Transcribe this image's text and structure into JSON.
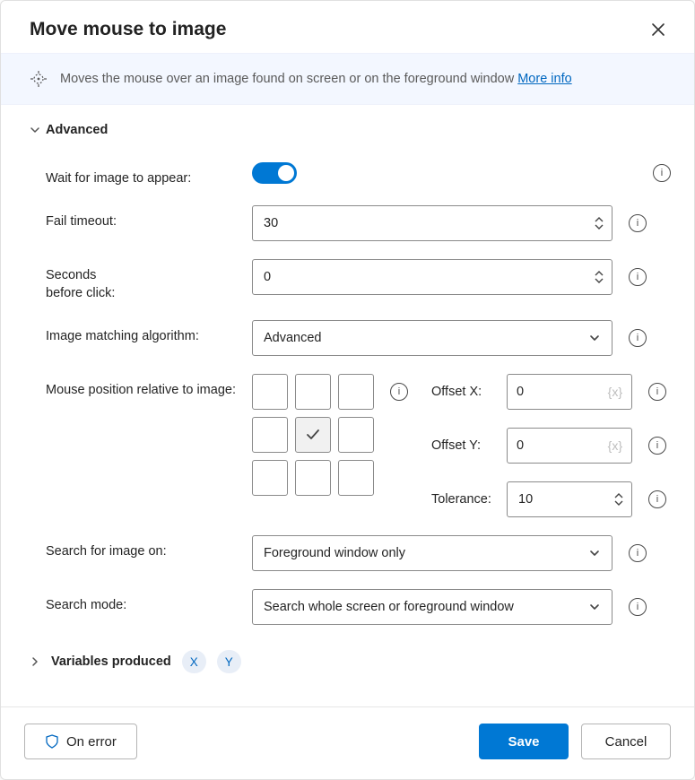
{
  "dialog": {
    "title": "Move mouse to image",
    "info_text": "Moves the mouse over an image found on screen or on the foreground window ",
    "info_link": "More info"
  },
  "advanced": {
    "section_label": "Advanced",
    "wait_label": "Wait for image to appear:",
    "wait_on": true,
    "fail_timeout_label": "Fail timeout:",
    "fail_timeout_value": "30",
    "seconds_before_label_line1": "Seconds",
    "seconds_before_label_line2": "before click:",
    "seconds_before_value": "0",
    "algo_label": "Image matching algorithm:",
    "algo_value": "Advanced",
    "pos_label": "Mouse position relative to image:",
    "offset_x_label": "Offset X:",
    "offset_x_value": "0",
    "offset_x_placeholder": "{x}",
    "offset_y_label": "Offset Y:",
    "offset_y_value": "0",
    "offset_y_placeholder": "{x}",
    "tolerance_label": "Tolerance:",
    "tolerance_value": "10",
    "search_on_label": "Search for image on:",
    "search_on_value": "Foreground window only",
    "search_mode_label": "Search mode:",
    "search_mode_value": "Search whole screen or foreground window"
  },
  "variables": {
    "section_label": "Variables produced",
    "chips": [
      "X",
      "Y"
    ]
  },
  "footer": {
    "on_error": "On error",
    "save": "Save",
    "cancel": "Cancel"
  }
}
